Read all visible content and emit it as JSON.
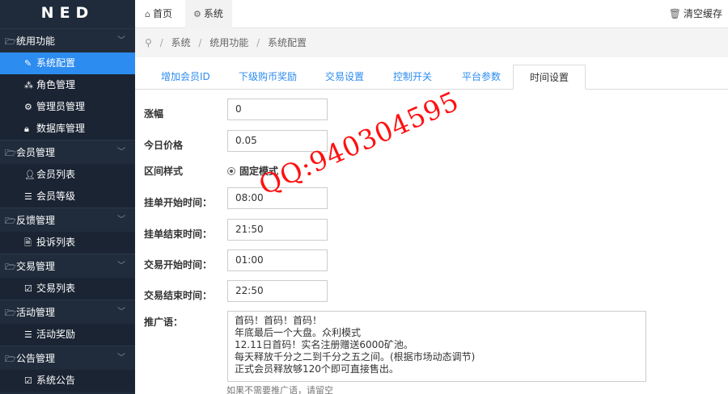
{
  "app": {
    "logo": "NED"
  },
  "sidebar": {
    "groups": [
      {
        "label": "统用功能",
        "items": [
          "系统配置",
          "角色管理",
          "管理员管理",
          "数据库管理"
        ]
      },
      {
        "label": "会员管理",
        "items": [
          "会员列表",
          "会员等级"
        ]
      },
      {
        "label": "反馈管理",
        "items": [
          "投诉列表"
        ]
      },
      {
        "label": "交易管理",
        "items": [
          "交易列表"
        ]
      },
      {
        "label": "活动管理",
        "items": [
          "活动奖励"
        ]
      },
      {
        "label": "公告管理",
        "items": [
          "系统公告"
        ]
      }
    ],
    "active": "系统配置"
  },
  "header": {
    "home_tab": "首页",
    "system_tab": "系统",
    "clear_cache": "清空缓存"
  },
  "breadcrumb": [
    "系统",
    "统用功能",
    "系统配置"
  ],
  "content_tabs": [
    "增加会员ID",
    "下级购币奖励",
    "交易设置",
    "控制开关",
    "平台参数",
    "时间设置"
  ],
  "active_tab": "时间设置",
  "form": {
    "rise_label": "涨幅",
    "rise_value": "0",
    "price_label": "今日价格",
    "price_value": "0.05",
    "range_label": "区间样式",
    "range_option": "固定模式",
    "order_start_label": "挂单开始时间：",
    "order_start_value": "08:00",
    "order_end_label": "挂单结束时间：",
    "order_end_value": "21:50",
    "trade_start_label": "交易开始时间：",
    "trade_start_value": "01:00",
    "trade_end_label": "交易结束时间：",
    "trade_end_value": "22:50",
    "promo_label": "推广语：",
    "promo_text": "首码！首码！首码！\n年底最后一个大盘。众利模式\n12.11日首码！实名注册赠送6000矿池。\n每天释放千分之二到千分之五之间。(根据市场动态调节)\n正式会员释放够120个即可直接售出。",
    "promo_hint": "如果不需要推广语，请留空"
  },
  "watermark": "QQ:940304595"
}
